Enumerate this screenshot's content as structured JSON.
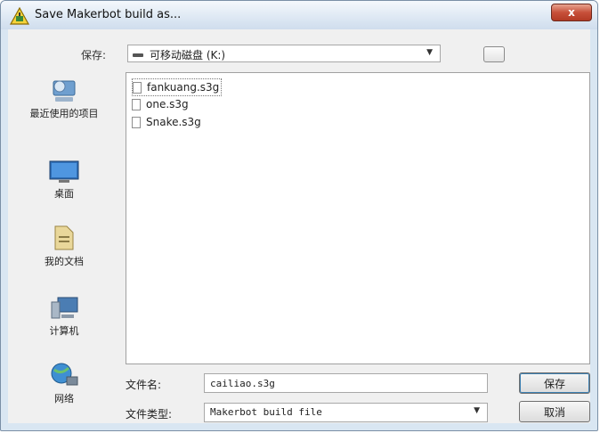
{
  "window": {
    "title": "Save Makerbot build as...",
    "close_glyph": "x"
  },
  "toolbar": {
    "save_in_label": "保存:",
    "location": "可移动磁盘 (K:)",
    "dropdown_glyph": "▼"
  },
  "places": [
    {
      "label": "最近使用的项目",
      "icon": "recent-places-icon"
    },
    {
      "label": "桌面",
      "icon": "desktop-icon"
    },
    {
      "label": "我的文档",
      "icon": "documents-icon"
    },
    {
      "label": "计算机",
      "icon": "computer-icon"
    },
    {
      "label": "网络",
      "icon": "network-icon"
    }
  ],
  "files": [
    {
      "name": "fankuang.s3g",
      "selected": true
    },
    {
      "name": "one.s3g",
      "selected": false
    },
    {
      "name": "Snake.s3g",
      "selected": false
    }
  ],
  "form": {
    "filename_label": "文件名:",
    "filename_value": "cailiao.s3g",
    "filetype_label": "文件类型:",
    "filetype_value": "Makerbot build file",
    "filetype_dropdown_glyph": "▼"
  },
  "buttons": {
    "save": "保存",
    "cancel": "取消"
  },
  "colors": {
    "titlebar": "#dfe9f4",
    "close_button": "#c7503a",
    "window_border": "#7a8fa6"
  }
}
